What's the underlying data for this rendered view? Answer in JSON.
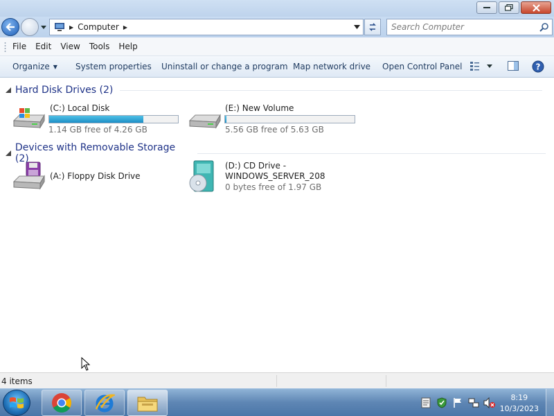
{
  "window": {
    "minimize": "minimize",
    "maximize": "maximize",
    "close": "close"
  },
  "address": {
    "location": "Computer",
    "search_placeholder": "Search Computer"
  },
  "menu": [
    "File",
    "Edit",
    "View",
    "Tools",
    "Help"
  ],
  "toolbar": {
    "organize": "Organize",
    "system_properties": "System properties",
    "uninstall": "Uninstall or change a program",
    "map_drive": "Map network drive",
    "control_panel": "Open Control Panel"
  },
  "groups": [
    {
      "title": "Hard Disk Drives (2)",
      "items": [
        {
          "name": "(C:) Local Disk",
          "free_text": "1.14 GB free of 4.26 GB",
          "used_fraction": 0.73,
          "icon": "windows-drive-icon"
        },
        {
          "name": "(E:) New Volume",
          "free_text": "5.56 GB free of 5.63 GB",
          "used_fraction": 0.012,
          "icon": "hard-drive-icon"
        }
      ]
    },
    {
      "title": "Devices with Removable Storage (2)",
      "items": [
        {
          "name": "(A:) Floppy Disk Drive",
          "icon": "floppy-drive-icon"
        },
        {
          "name_line1": "(D:) CD Drive -",
          "name_line2": "WINDOWS_SERVER_208",
          "free_text": "0 bytes free of 1.97 GB",
          "icon": "cd-drive-icon"
        }
      ]
    }
  ],
  "status": {
    "count": "4 items"
  },
  "taskbar": {
    "apps": [
      "chrome-icon",
      "internet-explorer-icon",
      "file-explorer-icon"
    ],
    "time": "8:19",
    "date": "10/3/2023"
  },
  "colors": {
    "accent": "#1e3287",
    "bar_fill": "#26a0da"
  }
}
